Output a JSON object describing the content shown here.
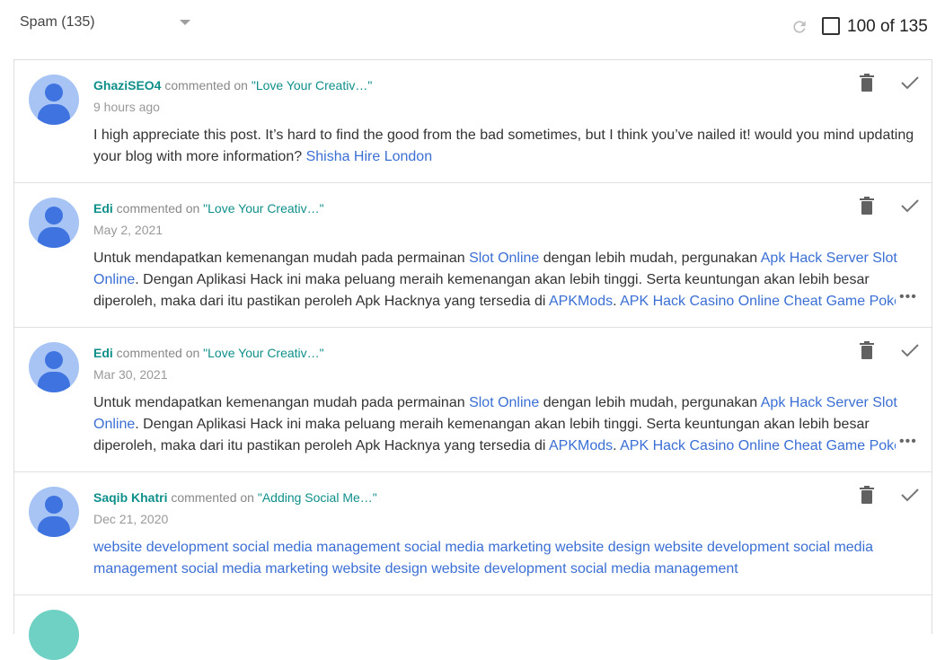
{
  "toolbar": {
    "filter_label": "Spam (135)",
    "count_label": "100 of 135",
    "icons": [
      "caret-down-icon",
      "refresh-icon",
      "checkbox-icon"
    ]
  },
  "comments": [
    {
      "author": "GhaziSEO4",
      "verb": " commented on ",
      "post": "\"Love Your Creativ…\"",
      "date": "9 hours ago",
      "line1_a": "I high appreciate this post. It’s hard to find the good from the bad sometimes, but I think you’ve nailed it! would you mind updating",
      "line2_a": "your blog with more information? ",
      "line2_link": "Shisha Hire London"
    },
    {
      "author": "Edi",
      "verb": " commented on ",
      "post": "\"Love Your Creativ…\"",
      "date": "May 2, 2021",
      "line1_a": "Untuk mendapatkan kemenangan mudah pada permainan ",
      "line1_link1": "Slot Online",
      "line1_b": " dengan lebih mudah, pergunakan ",
      "line1_link2": "Apk Hack Server Slot",
      "line2_link": "Online",
      "line2_a": ". Dengan Aplikasi Hack ini maka peluang meraih kemenangan akan lebih tinggi. Serta keuntungan akan lebih besar",
      "line3_a": "diperoleh, maka dari itu pastikan peroleh Apk Hacknya yang tersedia di ",
      "line3_link1": "APKMods",
      "line3_b": ". ",
      "line3_link2": "APK Hack Casino Online Cheat Game Poker"
    },
    {
      "author": "Edi",
      "verb": " commented on ",
      "post": "\"Love Your Creativ…\"",
      "date": "Mar 30, 2021",
      "line1_a": "Untuk mendapatkan kemenangan mudah pada permainan ",
      "line1_link1": "Slot Online",
      "line1_b": " dengan lebih mudah, pergunakan ",
      "line1_link2": "Apk Hack Server Slot",
      "line2_link": "Online",
      "line2_a": ". Dengan Aplikasi Hack ini maka peluang meraih kemenangan akan lebih tinggi. Serta keuntungan akan lebih besar",
      "line3_a": "diperoleh, maka dari itu pastikan peroleh Apk Hacknya yang tersedia di ",
      "line3_link1": "APKMods",
      "line3_b": ". ",
      "line3_link2": "APK Hack Casino Online Cheat Game Poker"
    },
    {
      "author": "Saqib Khatri",
      "verb": " commented on ",
      "post": "\"Adding Social Me…\"",
      "date": "Dec 21, 2020",
      "line1_link": "website development social media management social media marketing website design website development social media",
      "line2_link": "management social media marketing website design website development social media management"
    }
  ],
  "more_label": "•••",
  "row_icons": [
    "trash-icon",
    "check-icon",
    "more-icon"
  ],
  "colors": {
    "author": "#0f8f8a",
    "link": "#3b6fd4",
    "avatar_bg": "#a7c4f5",
    "avatar_fg": "#3f74e0"
  }
}
